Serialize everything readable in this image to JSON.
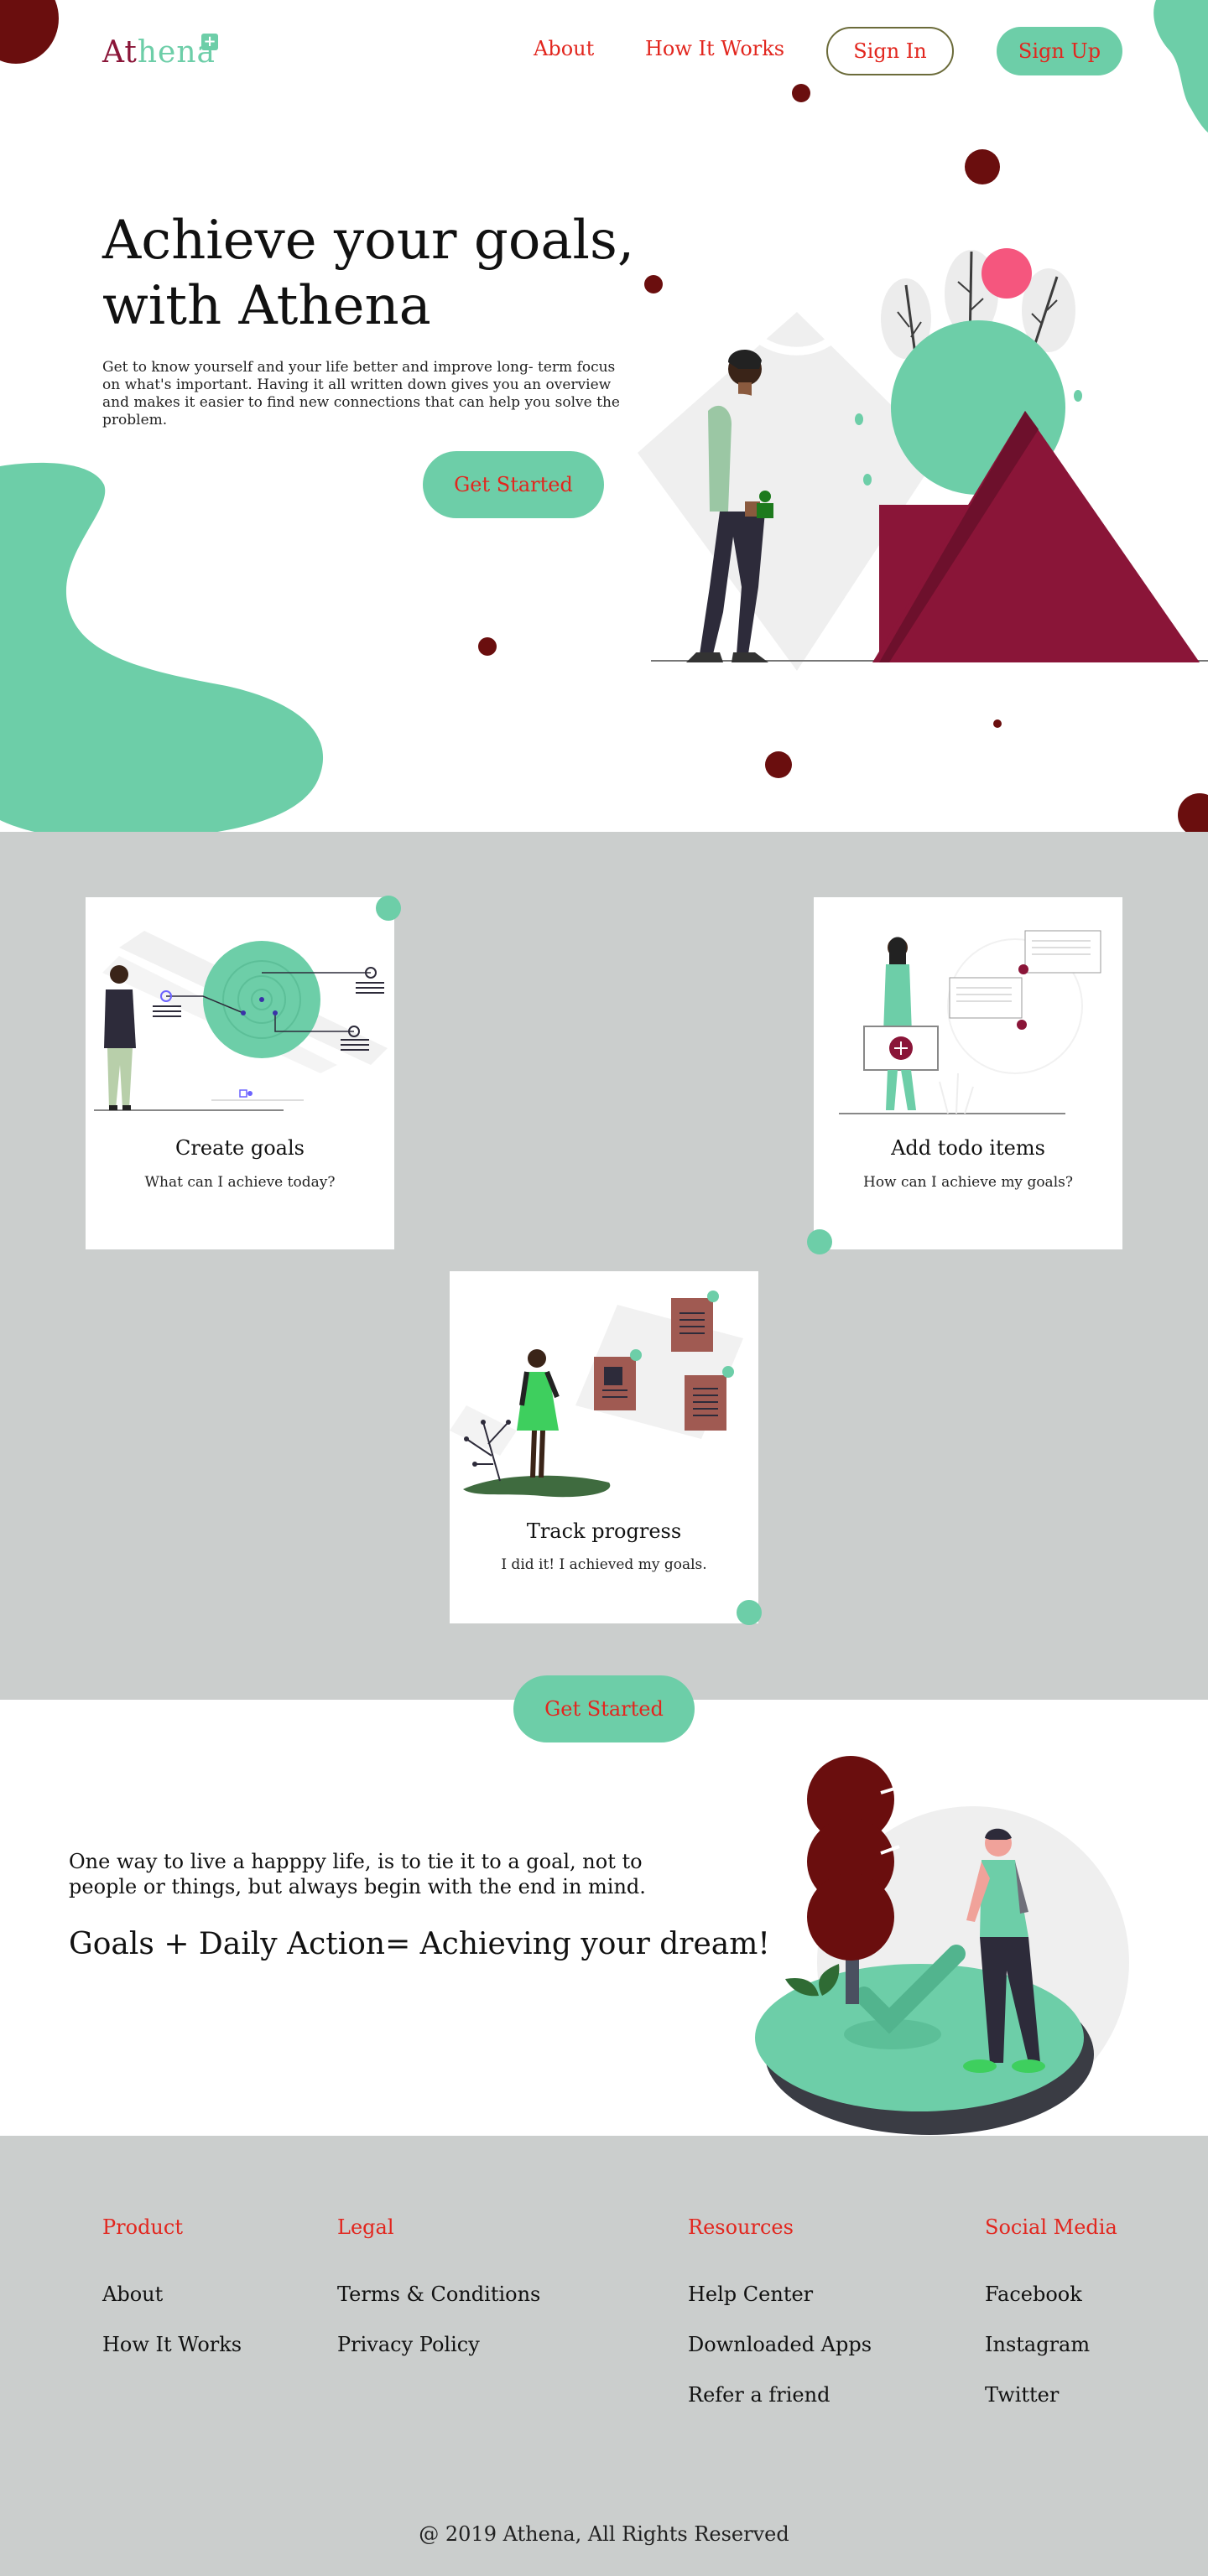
{
  "brand": {
    "name_part1": "At",
    "name_part2": "hena"
  },
  "nav": {
    "about": "About",
    "how_it_works": "How It Works",
    "sign_in": "Sign In",
    "sign_up": "Sign Up"
  },
  "hero": {
    "title_line1": "Achieve your goals,",
    "title_line2": "with Athena",
    "description": "Get to know yourself and your life better and improve long- term focus on what's important. Having it all written down gives you an overview and makes it easier to find new connections that can help you solve the problem.",
    "cta": "Get Started"
  },
  "features": {
    "cards": [
      {
        "title": "Create goals",
        "subtitle": "What can I achieve today?"
      },
      {
        "title": "Add todo items",
        "subtitle": "How can I achieve my goals?"
      },
      {
        "title": "Track progress",
        "subtitle": "I did it! I achieved my goals."
      }
    ],
    "cta": "Get Started"
  },
  "quote": {
    "text": "One way to live a happpy life, is to tie it to a goal, not to people or things, but always begin with the end in mind.",
    "equation": "Goals + Daily Action= Achieving your dream!"
  },
  "footer": {
    "columns": [
      {
        "heading": "Product",
        "links": [
          "About",
          "How It Works"
        ]
      },
      {
        "heading": "Legal",
        "links": [
          "Terms & Conditions",
          "Privacy Policy"
        ]
      },
      {
        "heading": "Resources",
        "links": [
          "Help Center",
          "Downloaded Apps",
          "Refer a friend"
        ]
      },
      {
        "heading": "Social Media",
        "links": [
          "Facebook",
          "Instagram",
          "Twitter"
        ]
      }
    ],
    "copyright": "@ 2019 Athena, All Rights Reserved"
  },
  "colors": {
    "accent_green": "#6dcea8",
    "accent_maroon": "#8a1538",
    "link_red": "#e2261e",
    "dark_red_dot": "#6a0e0e",
    "section_gray": "#cbcecd"
  }
}
